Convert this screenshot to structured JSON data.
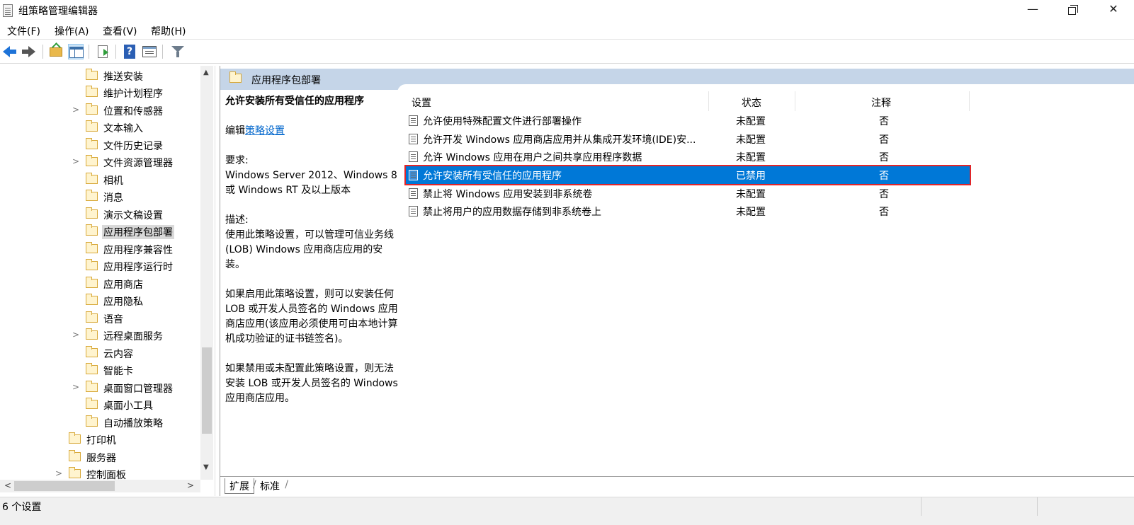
{
  "window": {
    "title": "组策略管理编辑器",
    "minimize": "—",
    "close": "✕"
  },
  "menu": [
    {
      "label": "文件(F)"
    },
    {
      "label": "操作(A)"
    },
    {
      "label": "查看(V)"
    },
    {
      "label": "帮助(H)"
    }
  ],
  "toolbar": {
    "icons": [
      "back-arrow-icon",
      "forward-arrow-icon",
      "up-folder-icon",
      "show-hide-tree-icon",
      "export-list-icon",
      "help-icon",
      "properties-icon",
      "filter-icon"
    ]
  },
  "tree": {
    "items": [
      {
        "label": "推送安装",
        "expandable": false
      },
      {
        "label": "维护计划程序",
        "expandable": false
      },
      {
        "label": "位置和传感器",
        "expandable": true
      },
      {
        "label": "文本输入",
        "expandable": false
      },
      {
        "label": "文件历史记录",
        "expandable": false
      },
      {
        "label": "文件资源管理器",
        "expandable": true
      },
      {
        "label": "相机",
        "expandable": false
      },
      {
        "label": "消息",
        "expandable": false
      },
      {
        "label": "演示文稿设置",
        "expandable": false
      },
      {
        "label": "应用程序包部署",
        "expandable": false,
        "selected": true
      },
      {
        "label": "应用程序兼容性",
        "expandable": false
      },
      {
        "label": "应用程序运行时",
        "expandable": false
      },
      {
        "label": "应用商店",
        "expandable": false
      },
      {
        "label": "应用隐私",
        "expandable": false
      },
      {
        "label": "语音",
        "expandable": false
      },
      {
        "label": "远程桌面服务",
        "expandable": true
      },
      {
        "label": "云内容",
        "expandable": false
      },
      {
        "label": "智能卡",
        "expandable": false
      },
      {
        "label": "桌面窗口管理器",
        "expandable": true
      },
      {
        "label": "桌面小工具",
        "expandable": false
      },
      {
        "label": "自动播放策略",
        "expandable": false
      }
    ],
    "parent_items": [
      {
        "label": "打印机",
        "expandable": false
      },
      {
        "label": "服务器",
        "expandable": false
      },
      {
        "label": "控制面板",
        "expandable": true
      }
    ]
  },
  "right_pane": {
    "header": "应用程序包部署",
    "description": {
      "title": "允许安装所有受信任的应用程序",
      "edit_prefix": "编辑",
      "edit_link": "策略设置",
      "requirements_label": "要求:",
      "requirements": "Windows Server 2012、Windows 8 或 Windows RT 及以上版本",
      "desc_label": "描述:",
      "desc_1": "使用此策略设置，可以管理可信业务线(LOB) Windows 应用商店应用的安装。",
      "desc_2": "如果启用此策略设置，则可以安装任何 LOB 或开发人员签名的 Windows 应用商店应用(该应用必须使用可由本地计算机成功验证的证书链签名)。",
      "desc_3": "如果禁用或未配置此策略设置，则无法安装 LOB 或开发人员签名的 Windows 应用商店应用。"
    },
    "columns": {
      "setting": "设置",
      "state": "状态",
      "comment": "注释"
    },
    "rows": [
      {
        "name": "允许使用特殊配置文件进行部署操作",
        "state": "未配置",
        "comment": "否"
      },
      {
        "name": "允许开发 Windows 应用商店应用并从集成开发环境(IDE)安...",
        "state": "未配置",
        "comment": "否"
      },
      {
        "name": "允许 Windows 应用在用户之间共享应用程序数据",
        "state": "未配置",
        "comment": "否"
      },
      {
        "name": "允许安装所有受信任的应用程序",
        "state": "已禁用",
        "comment": "否",
        "selected": true
      },
      {
        "name": "禁止将 Windows 应用安装到非系统卷",
        "state": "未配置",
        "comment": "否"
      },
      {
        "name": "禁止将用户的应用数据存储到非系统卷上",
        "state": "未配置",
        "comment": "否"
      }
    ],
    "tabs": {
      "extended": "扩展",
      "standard": "标准"
    }
  },
  "status": {
    "text": "6 个设置"
  },
  "colors": {
    "selection": "#0078d7",
    "highlight_outline": "#e0262a",
    "header_bg": "#c5d5e8",
    "link": "#0066cc"
  }
}
